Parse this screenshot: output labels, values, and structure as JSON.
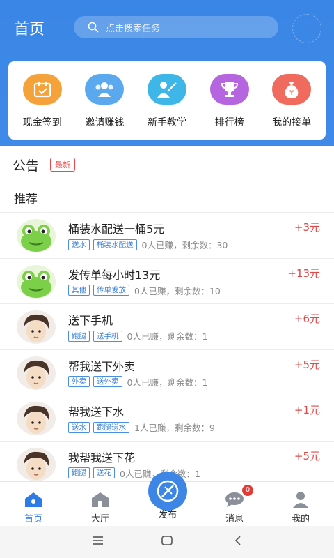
{
  "header": {
    "title": "首页",
    "search_placeholder": "点击搜索任务"
  },
  "quick_actions": [
    {
      "label": "现金签到",
      "icon": "calendar-check-icon",
      "color": "#f5a23b"
    },
    {
      "label": "邀请赚钱",
      "icon": "group-icon",
      "color": "#5aa9ef"
    },
    {
      "label": "新手教学",
      "icon": "teacher-icon",
      "color": "#3fb6e8"
    },
    {
      "label": "排行榜",
      "icon": "trophy-icon",
      "color": "#b665e0"
    },
    {
      "label": "我的接单",
      "icon": "money-bag-icon",
      "color": "#f06a5e"
    }
  ],
  "notice": {
    "title": "公告",
    "badge": "最新"
  },
  "section_title": "推荐",
  "tasks": [
    {
      "title": "桶装水配送一桶5元",
      "price": "+3元",
      "tags": [
        "送水",
        "桶装水配送"
      ],
      "meta": "0人已赚，剩余数：30",
      "avatar": "frog"
    },
    {
      "title": "发传单每小时13元",
      "price": "+13元",
      "tags": [
        "其他",
        "传单发放"
      ],
      "meta": "0人已赚，剩余数：10",
      "avatar": "frog"
    },
    {
      "title": "送下手机",
      "price": "+6元",
      "tags": [
        "跑腿",
        "送手机"
      ],
      "meta": "0人已赚，剩余数：1",
      "avatar": "anime"
    },
    {
      "title": "帮我送下外卖",
      "price": "+5元",
      "tags": [
        "外卖",
        "送外卖"
      ],
      "meta": "0人已赚，剩余数：1",
      "avatar": "anime"
    },
    {
      "title": "帮我送下水",
      "price": "+1元",
      "tags": [
        "送水",
        "跑腿送水"
      ],
      "meta": "1人已赚，剩余数：9",
      "avatar": "anime"
    },
    {
      "title": "我帮我送下花",
      "price": "+5元",
      "tags": [
        "跑腿",
        "送花"
      ],
      "meta": "0人已赚，剩余数：1",
      "avatar": "anime"
    }
  ],
  "tabbar": {
    "home": "首页",
    "hall": "大厅",
    "publish": "发布",
    "messages": "消息",
    "messages_badge": "0",
    "mine": "我的"
  },
  "colors": {
    "primary": "#3a86e6",
    "price": "#e04848",
    "tag": "#4a90e2"
  }
}
